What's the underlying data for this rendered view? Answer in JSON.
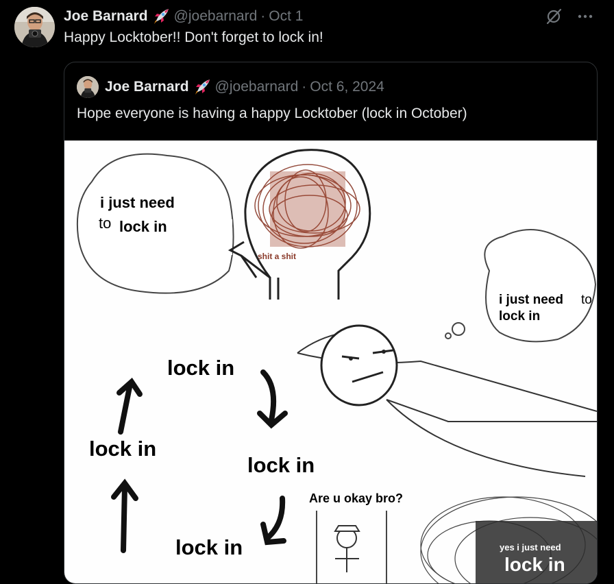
{
  "tweet": {
    "author_name": "Joe Barnard",
    "handle": "@joebarnard",
    "separator": "·",
    "date": "Oct 1",
    "text": "Happy Locktober!! Don't forget to lock in!"
  },
  "quoted_tweet": {
    "author_name": "Joe Barnard",
    "handle": "@joebarnard",
    "separator": "·",
    "date": "Oct 6, 2024",
    "text": "Hope everyone is having a happy Locktober (lock in October)"
  },
  "meme": {
    "bubble_line1": "i just need",
    "bubble_line2_to": "to",
    "bubble_line2_lock": "lock in",
    "head_scribble_text": "shit a shit",
    "thought_line1": "i just need",
    "thought_to": "to",
    "thought_line2": "lock in",
    "cycle_top": "lock in",
    "cycle_right": "lock in",
    "cycle_left": "lock in",
    "cycle_bottom": "lock in",
    "friend_question": "Are u okay bro?",
    "bottom_right_line1": "yes i just need",
    "bottom_right_line2": "lock in"
  },
  "icons": {
    "grok": "slash-circle-icon",
    "more": "more-dots-icon",
    "rocket": "rocket-emoji-icon"
  },
  "colors": {
    "background": "#000000",
    "text_primary": "#e7e9ea",
    "text_muted": "#71767b",
    "border": "#2f3336"
  }
}
